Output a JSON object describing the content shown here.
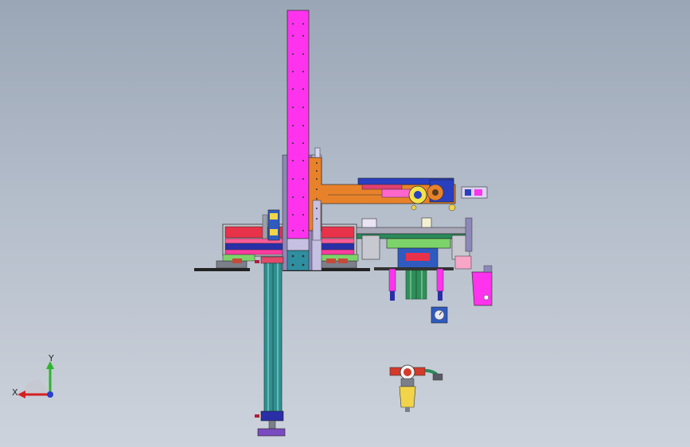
{
  "triad": {
    "x_label": "X",
    "y_label": "Y"
  },
  "colors": {
    "background_top": "#9aa6b6",
    "background_bottom": "#cdd3dc",
    "column": "#ff33ee",
    "arm": "#e8822a",
    "base_red": "#e8324a",
    "rail_green": "#7cd36a",
    "cylinder": "#2f8f8f",
    "gripper_blue": "#2a3fc0",
    "regulator": "#d43a2a"
  },
  "icons": [
    "triad-icon",
    "regulator-icon",
    "gauge-icon"
  ]
}
